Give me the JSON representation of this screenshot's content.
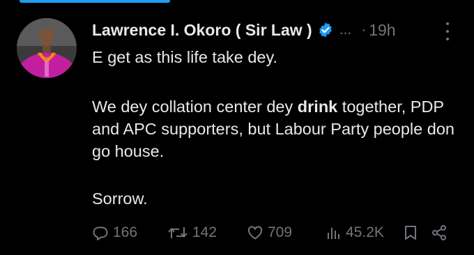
{
  "colors": {
    "background": "#000000",
    "text": "#e7e9ea",
    "muted": "#71767b",
    "verified_blue": "#1d9bf0",
    "avatar_robe": "#c21f9f"
  },
  "tweet": {
    "author_name": "Lawrence I. Okoro ( Sir Law )",
    "verified_icon": "verified-badge-icon",
    "handle_truncated": "...",
    "separator": "·",
    "time": "19h",
    "text": {
      "line1": "E get as this life take dey.",
      "p2_before": "We dey collation center dey ",
      "p2_bold": "drink",
      "p2_after": " together, PDP and APC supporters, but Labour Party people don go house.",
      "line3": "Sorrow."
    },
    "actions": {
      "replies": "166",
      "reposts": "142",
      "likes": "709",
      "views": "45.2K",
      "icons": [
        "reply-icon",
        "repost-icon",
        "like-icon",
        "views-icon",
        "bookmark-icon",
        "share-icon"
      ]
    }
  }
}
